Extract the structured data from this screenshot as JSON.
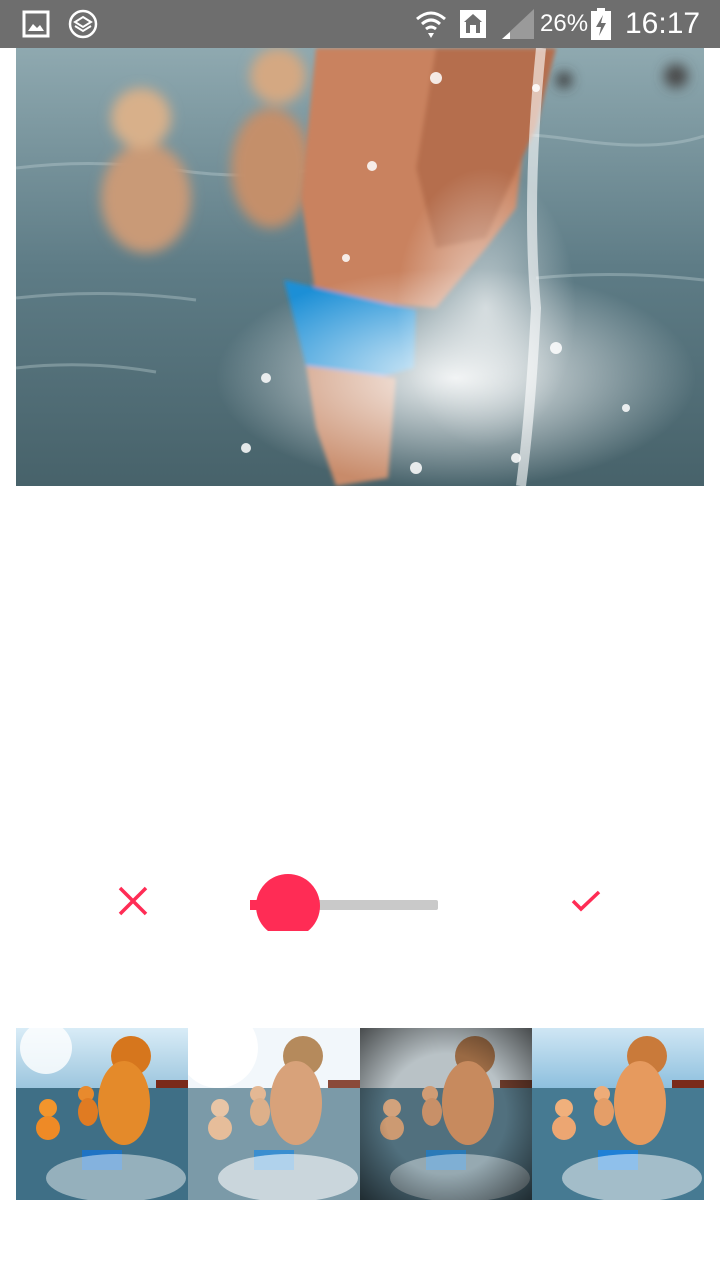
{
  "status_bar": {
    "battery_percent": "26%",
    "time": "16:17",
    "icons": [
      "gallery-icon",
      "layers-icon",
      "wifi-icon",
      "home-icon",
      "signal-icon",
      "battery-charging-icon"
    ]
  },
  "editor": {
    "main_photo": "kids-splashing-in-sea-photo",
    "cancel_icon": "close-icon",
    "confirm_icon": "check-icon",
    "intensity_slider_value": 0.05,
    "accent_color": "#ff2c55"
  },
  "filters": {
    "items": [
      {
        "name": "filter-warm",
        "tint": "#ff8a1a"
      },
      {
        "name": "filter-bright",
        "tint": "#ffffff"
      },
      {
        "name": "filter-vignette",
        "tint": "#303030"
      },
      {
        "name": "filter-vivid",
        "tint": "#ffb060"
      }
    ]
  }
}
